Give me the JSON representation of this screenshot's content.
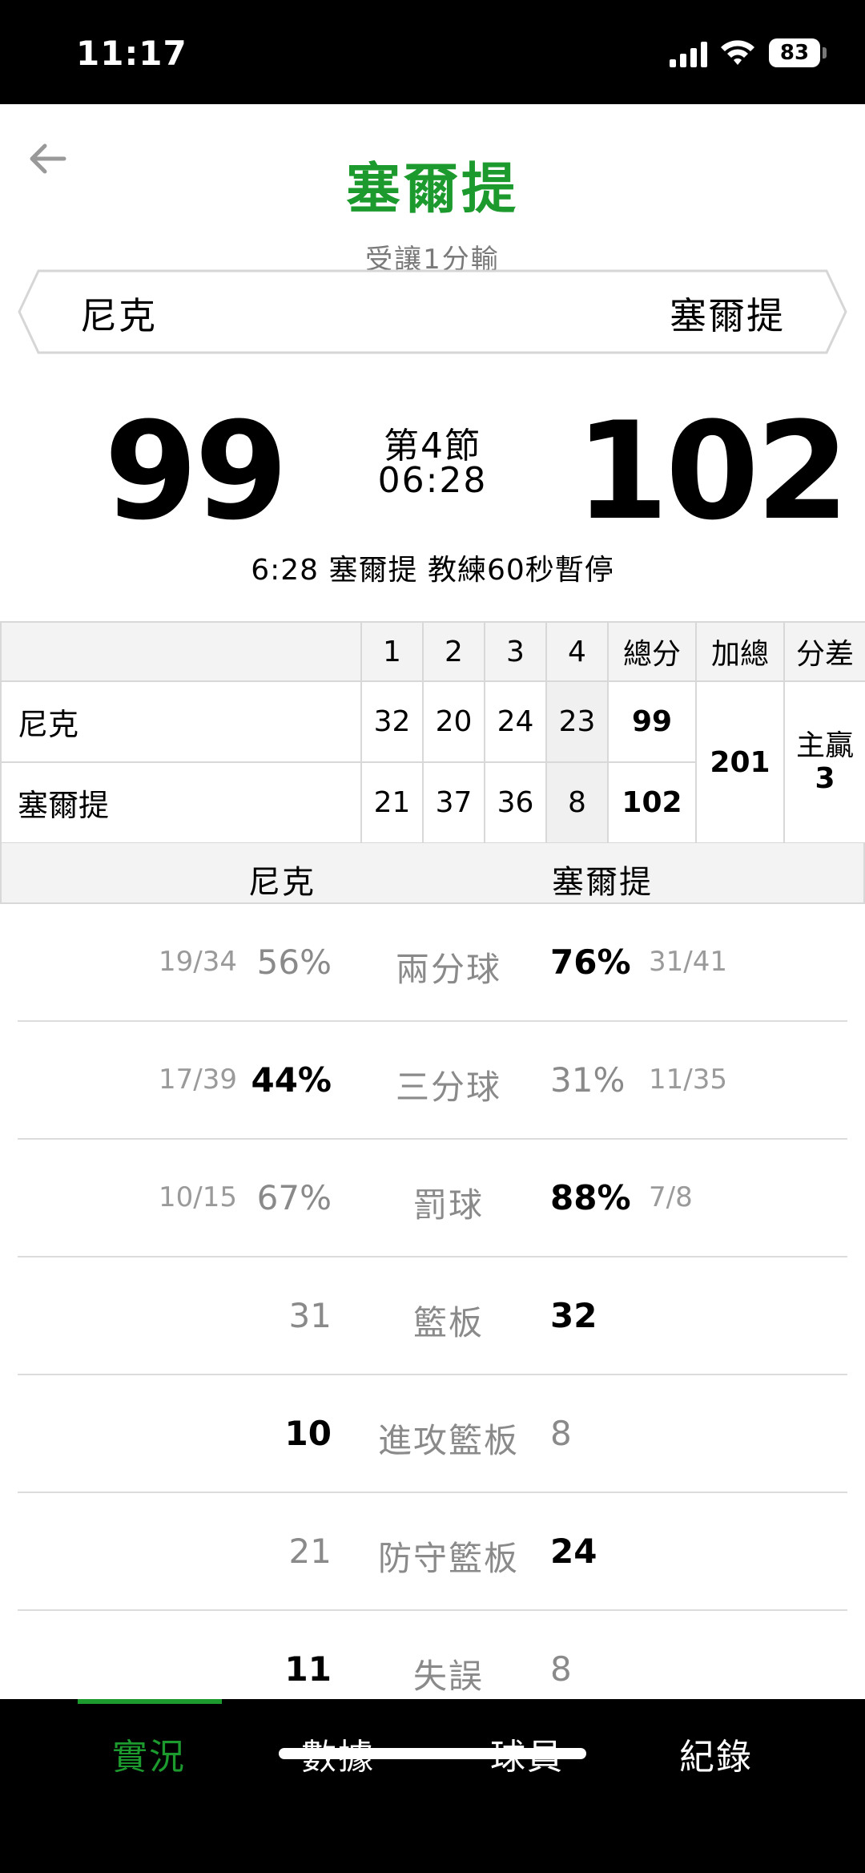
{
  "status": {
    "time": "11:17",
    "battery": "83"
  },
  "header": {
    "title": "塞爾提",
    "handicap": "受讓1分輸"
  },
  "teams": {
    "away": "尼克",
    "home": "塞爾提"
  },
  "score": {
    "away": "99",
    "home": "102",
    "period": "第4節",
    "clock": "06:28"
  },
  "event": "6:28 塞爾提  教練60秒暫停",
  "linescore": {
    "headers": [
      "1",
      "2",
      "3",
      "4",
      "總分",
      "加總",
      "分差"
    ],
    "away": {
      "name": "尼克",
      "q": [
        "32",
        "20",
        "24",
        "23"
      ],
      "total": "99"
    },
    "home": {
      "name": "塞爾提",
      "q": [
        "21",
        "37",
        "36",
        "8"
      ],
      "total": "102"
    },
    "combined": "201",
    "diff_label": "主贏",
    "diff_value": "3"
  },
  "stats_header": {
    "away": "尼克",
    "home": "塞爾提"
  },
  "stats": [
    {
      "label": "兩分球",
      "away_frac": "19/34",
      "away": "56%",
      "home": "76%",
      "home_frac": "31/41",
      "leader": "home"
    },
    {
      "label": "三分球",
      "away_frac": "17/39",
      "away": "44%",
      "home": "31%",
      "home_frac": "11/35",
      "leader": "away"
    },
    {
      "label": "罰球",
      "away_frac": "10/15",
      "away": "67%",
      "home": "88%",
      "home_frac": "7/8",
      "leader": "home"
    },
    {
      "label": "籃板",
      "away_frac": "",
      "away": "31",
      "home": "32",
      "home_frac": "",
      "leader": "home"
    },
    {
      "label": "進攻籃板",
      "away_frac": "",
      "away": "10",
      "home": "8",
      "home_frac": "",
      "leader": "away"
    },
    {
      "label": "防守籃板",
      "away_frac": "",
      "away": "21",
      "home": "24",
      "home_frac": "",
      "leader": "home"
    },
    {
      "label": "失誤",
      "away_frac": "",
      "away": "11",
      "home": "8",
      "home_frac": "",
      "leader": "away"
    }
  ],
  "nav": {
    "tabs": [
      "實況",
      "數據",
      "球員",
      "紀錄"
    ],
    "active": 0
  },
  "colors": {
    "accent": "#1c9a2e"
  }
}
